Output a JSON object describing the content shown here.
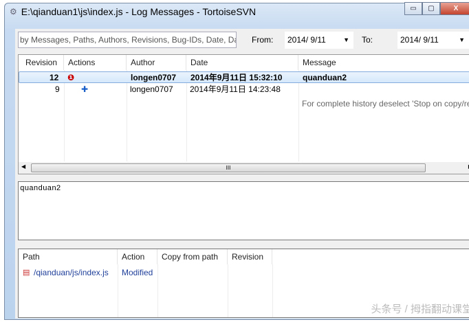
{
  "window": {
    "title": "E:\\qianduan1\\js\\index.js - Log Messages - TortoiseSVN",
    "minimize": "▭",
    "maximize": "▢",
    "close": "X"
  },
  "filter": {
    "placeholder": "by Messages, Paths, Authors, Revisions, Bug-IDs, Date, Date",
    "from_label": "From:",
    "from_value": "2014/ 9/11",
    "to_label": "To:",
    "to_value": "2014/ 9/11"
  },
  "log": {
    "columns": [
      "Revision",
      "Actions",
      "Author",
      "Date",
      "Message"
    ],
    "rows": [
      {
        "revision": "12",
        "action_icon": "modified-error-icon",
        "author": "longen0707",
        "date": "2014年9月11日 15:32:10",
        "message": "quanduan2",
        "selected": true
      },
      {
        "revision": "9",
        "action_icon": "added-icon",
        "author": "longen0707",
        "date": "2014年9月11日 14:23:48",
        "message": ""
      }
    ],
    "note": "For complete history deselect 'Stop on copy/re"
  },
  "scroll_thumb": "III",
  "message_text": "quanduan2",
  "paths": {
    "columns": [
      "Path",
      "Action",
      "Copy from path",
      "Revision"
    ],
    "rows": [
      {
        "path": "/qianduan/js/index.js",
        "action": "Modified",
        "copy_from": "",
        "revision": ""
      }
    ]
  },
  "watermark": "头条号 / 拇指翻动课堂"
}
